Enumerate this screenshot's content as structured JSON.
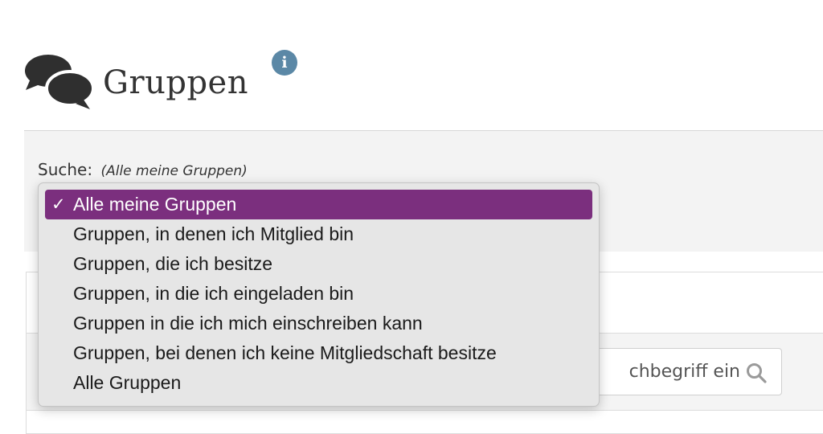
{
  "header": {
    "title": "Gruppen",
    "info_glyph": "i",
    "icon": "speech-bubbles-icon"
  },
  "search": {
    "label": "Suche:",
    "current_value": "(Alle meine Gruppen)"
  },
  "dropdown": {
    "selected_index": 0,
    "check_glyph": "✓",
    "selected_color": "#7b2f7e",
    "options": [
      "Alle meine Gruppen",
      "Gruppen, in denen ich Mitglied bin",
      "Gruppen, die ich besitze",
      "Gruppen, in die ich eingeladen bin",
      "Gruppen in die ich mich einschreiben kann",
      "Gruppen, bei denen ich keine Mitgliedschaft besitze",
      "Alle Gruppen"
    ]
  },
  "search_field": {
    "visible_placeholder": "chbegriff ein"
  }
}
